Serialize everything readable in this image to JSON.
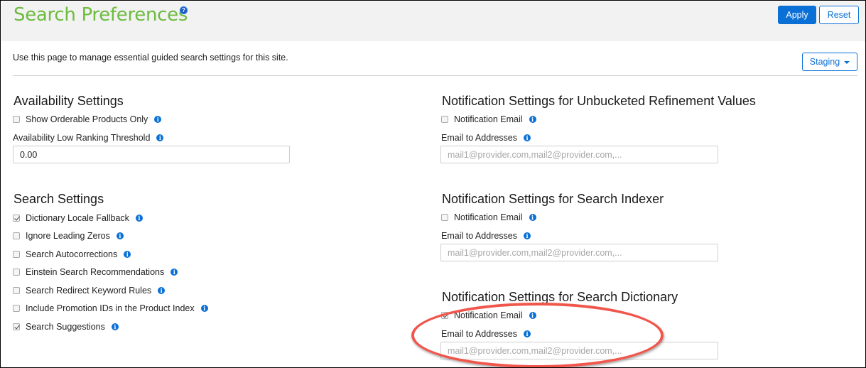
{
  "header": {
    "title": "Search Preferences",
    "help_icon": "question-circle-icon",
    "apply_label": "Apply",
    "reset_label": "Reset"
  },
  "intro_text": "Use this page to manage essential guided search settings for this site.",
  "instance_selector": {
    "value": "Staging",
    "icon": "caret-down-icon"
  },
  "availability": {
    "title": "Availability Settings",
    "show_orderable": {
      "label": "Show Orderable Products Only",
      "checked": false
    },
    "threshold": {
      "label": "Availability Low Ranking Threshold",
      "value": "0.00"
    }
  },
  "search_settings": {
    "title": "Search Settings",
    "items": [
      {
        "label": "Dictionary Locale Fallback",
        "checked": true
      },
      {
        "label": "Ignore Leading Zeros",
        "checked": false
      },
      {
        "label": "Search Autocorrections",
        "checked": false
      },
      {
        "label": "Einstein Search Recommendations",
        "checked": false
      },
      {
        "label": "Search Redirect Keyword Rules",
        "checked": false
      },
      {
        "label": "Include Promotion IDs in the Product Index",
        "checked": false
      },
      {
        "label": "Search Suggestions",
        "checked": true
      }
    ]
  },
  "notifications": [
    {
      "title": "Notification Settings for Unbucketed Refinement Values",
      "email_label": "Notification Email",
      "email_checked": false,
      "addresses_label": "Email to Addresses",
      "addresses_placeholder": "mail1@provider.com,mail2@provider.com,...",
      "addresses_value": ""
    },
    {
      "title": "Notification Settings for Search Indexer",
      "email_label": "Notification Email",
      "email_checked": false,
      "addresses_label": "Email to Addresses",
      "addresses_placeholder": "mail1@provider.com,mail2@provider.com,...",
      "addresses_value": ""
    },
    {
      "title": "Notification Settings for Search Dictionary",
      "email_label": "Notification Email",
      "email_checked": true,
      "addresses_label": "Email to Addresses",
      "addresses_placeholder": "mail1@provider.com,mail2@provider.com,...",
      "addresses_value": ""
    }
  ],
  "info_icon_glyph": "i",
  "help_icon_glyph": "?",
  "colors": {
    "title_green": "#6dbb3f",
    "primary_blue": "#0a70d6",
    "highlight_red": "#f0564b"
  }
}
